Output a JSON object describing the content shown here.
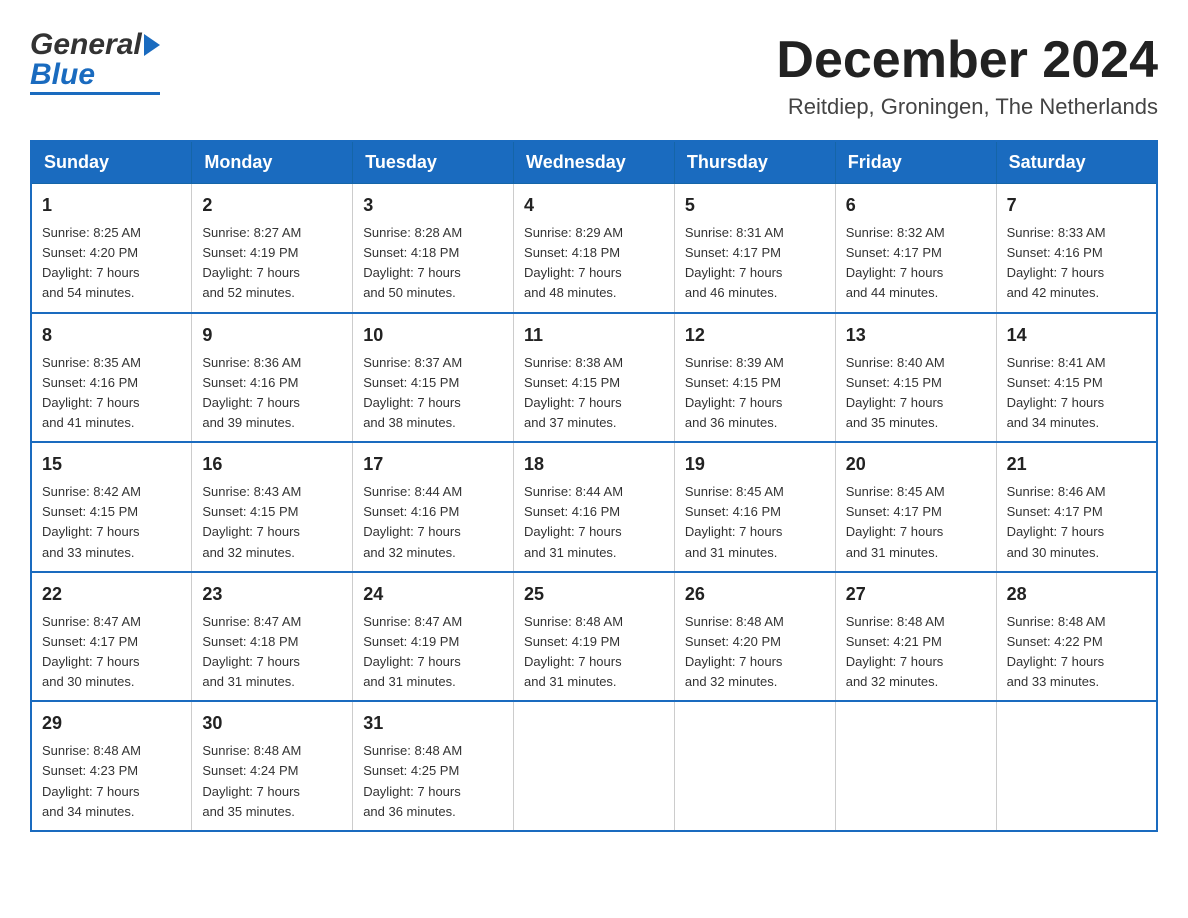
{
  "header": {
    "logo_general": "General",
    "logo_blue": "Blue",
    "month_title": "December 2024",
    "location": "Reitdiep, Groningen, The Netherlands"
  },
  "days_of_week": [
    "Sunday",
    "Monday",
    "Tuesday",
    "Wednesday",
    "Thursday",
    "Friday",
    "Saturday"
  ],
  "weeks": [
    [
      {
        "day": "1",
        "sunrise": "Sunrise: 8:25 AM",
        "sunset": "Sunset: 4:20 PM",
        "daylight": "Daylight: 7 hours",
        "minutes": "and 54 minutes."
      },
      {
        "day": "2",
        "sunrise": "Sunrise: 8:27 AM",
        "sunset": "Sunset: 4:19 PM",
        "daylight": "Daylight: 7 hours",
        "minutes": "and 52 minutes."
      },
      {
        "day": "3",
        "sunrise": "Sunrise: 8:28 AM",
        "sunset": "Sunset: 4:18 PM",
        "daylight": "Daylight: 7 hours",
        "minutes": "and 50 minutes."
      },
      {
        "day": "4",
        "sunrise": "Sunrise: 8:29 AM",
        "sunset": "Sunset: 4:18 PM",
        "daylight": "Daylight: 7 hours",
        "minutes": "and 48 minutes."
      },
      {
        "day": "5",
        "sunrise": "Sunrise: 8:31 AM",
        "sunset": "Sunset: 4:17 PM",
        "daylight": "Daylight: 7 hours",
        "minutes": "and 46 minutes."
      },
      {
        "day": "6",
        "sunrise": "Sunrise: 8:32 AM",
        "sunset": "Sunset: 4:17 PM",
        "daylight": "Daylight: 7 hours",
        "minutes": "and 44 minutes."
      },
      {
        "day": "7",
        "sunrise": "Sunrise: 8:33 AM",
        "sunset": "Sunset: 4:16 PM",
        "daylight": "Daylight: 7 hours",
        "minutes": "and 42 minutes."
      }
    ],
    [
      {
        "day": "8",
        "sunrise": "Sunrise: 8:35 AM",
        "sunset": "Sunset: 4:16 PM",
        "daylight": "Daylight: 7 hours",
        "minutes": "and 41 minutes."
      },
      {
        "day": "9",
        "sunrise": "Sunrise: 8:36 AM",
        "sunset": "Sunset: 4:16 PM",
        "daylight": "Daylight: 7 hours",
        "minutes": "and 39 minutes."
      },
      {
        "day": "10",
        "sunrise": "Sunrise: 8:37 AM",
        "sunset": "Sunset: 4:15 PM",
        "daylight": "Daylight: 7 hours",
        "minutes": "and 38 minutes."
      },
      {
        "day": "11",
        "sunrise": "Sunrise: 8:38 AM",
        "sunset": "Sunset: 4:15 PM",
        "daylight": "Daylight: 7 hours",
        "minutes": "and 37 minutes."
      },
      {
        "day": "12",
        "sunrise": "Sunrise: 8:39 AM",
        "sunset": "Sunset: 4:15 PM",
        "daylight": "Daylight: 7 hours",
        "minutes": "and 36 minutes."
      },
      {
        "day": "13",
        "sunrise": "Sunrise: 8:40 AM",
        "sunset": "Sunset: 4:15 PM",
        "daylight": "Daylight: 7 hours",
        "minutes": "and 35 minutes."
      },
      {
        "day": "14",
        "sunrise": "Sunrise: 8:41 AM",
        "sunset": "Sunset: 4:15 PM",
        "daylight": "Daylight: 7 hours",
        "minutes": "and 34 minutes."
      }
    ],
    [
      {
        "day": "15",
        "sunrise": "Sunrise: 8:42 AM",
        "sunset": "Sunset: 4:15 PM",
        "daylight": "Daylight: 7 hours",
        "minutes": "and 33 minutes."
      },
      {
        "day": "16",
        "sunrise": "Sunrise: 8:43 AM",
        "sunset": "Sunset: 4:15 PM",
        "daylight": "Daylight: 7 hours",
        "minutes": "and 32 minutes."
      },
      {
        "day": "17",
        "sunrise": "Sunrise: 8:44 AM",
        "sunset": "Sunset: 4:16 PM",
        "daylight": "Daylight: 7 hours",
        "minutes": "and 32 minutes."
      },
      {
        "day": "18",
        "sunrise": "Sunrise: 8:44 AM",
        "sunset": "Sunset: 4:16 PM",
        "daylight": "Daylight: 7 hours",
        "minutes": "and 31 minutes."
      },
      {
        "day": "19",
        "sunrise": "Sunrise: 8:45 AM",
        "sunset": "Sunset: 4:16 PM",
        "daylight": "Daylight: 7 hours",
        "minutes": "and 31 minutes."
      },
      {
        "day": "20",
        "sunrise": "Sunrise: 8:45 AM",
        "sunset": "Sunset: 4:17 PM",
        "daylight": "Daylight: 7 hours",
        "minutes": "and 31 minutes."
      },
      {
        "day": "21",
        "sunrise": "Sunrise: 8:46 AM",
        "sunset": "Sunset: 4:17 PM",
        "daylight": "Daylight: 7 hours",
        "minutes": "and 30 minutes."
      }
    ],
    [
      {
        "day": "22",
        "sunrise": "Sunrise: 8:47 AM",
        "sunset": "Sunset: 4:17 PM",
        "daylight": "Daylight: 7 hours",
        "minutes": "and 30 minutes."
      },
      {
        "day": "23",
        "sunrise": "Sunrise: 8:47 AM",
        "sunset": "Sunset: 4:18 PM",
        "daylight": "Daylight: 7 hours",
        "minutes": "and 31 minutes."
      },
      {
        "day": "24",
        "sunrise": "Sunrise: 8:47 AM",
        "sunset": "Sunset: 4:19 PM",
        "daylight": "Daylight: 7 hours",
        "minutes": "and 31 minutes."
      },
      {
        "day": "25",
        "sunrise": "Sunrise: 8:48 AM",
        "sunset": "Sunset: 4:19 PM",
        "daylight": "Daylight: 7 hours",
        "minutes": "and 31 minutes."
      },
      {
        "day": "26",
        "sunrise": "Sunrise: 8:48 AM",
        "sunset": "Sunset: 4:20 PM",
        "daylight": "Daylight: 7 hours",
        "minutes": "and 32 minutes."
      },
      {
        "day": "27",
        "sunrise": "Sunrise: 8:48 AM",
        "sunset": "Sunset: 4:21 PM",
        "daylight": "Daylight: 7 hours",
        "minutes": "and 32 minutes."
      },
      {
        "day": "28",
        "sunrise": "Sunrise: 8:48 AM",
        "sunset": "Sunset: 4:22 PM",
        "daylight": "Daylight: 7 hours",
        "minutes": "and 33 minutes."
      }
    ],
    [
      {
        "day": "29",
        "sunrise": "Sunrise: 8:48 AM",
        "sunset": "Sunset: 4:23 PM",
        "daylight": "Daylight: 7 hours",
        "minutes": "and 34 minutes."
      },
      {
        "day": "30",
        "sunrise": "Sunrise: 8:48 AM",
        "sunset": "Sunset: 4:24 PM",
        "daylight": "Daylight: 7 hours",
        "minutes": "and 35 minutes."
      },
      {
        "day": "31",
        "sunrise": "Sunrise: 8:48 AM",
        "sunset": "Sunset: 4:25 PM",
        "daylight": "Daylight: 7 hours",
        "minutes": "and 36 minutes."
      },
      null,
      null,
      null,
      null
    ]
  ]
}
